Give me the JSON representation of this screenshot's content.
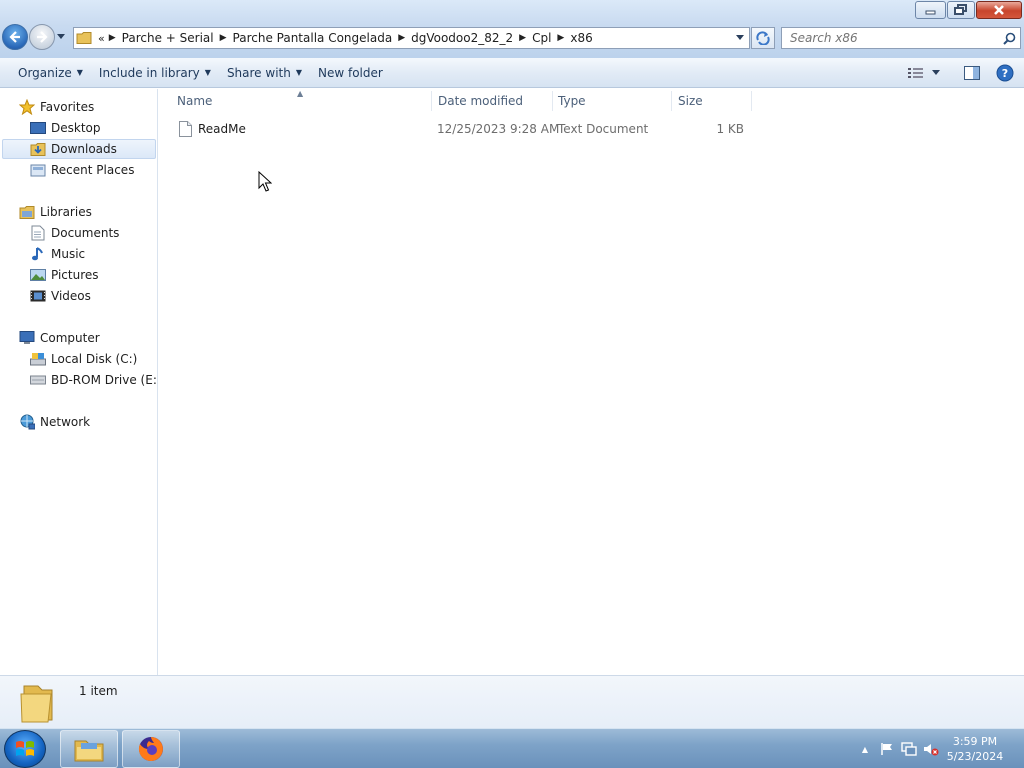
{
  "window": {
    "controls": {
      "minimize": "minimize",
      "maximize": "restore",
      "close": "close"
    }
  },
  "address": {
    "overflow": "«",
    "crumbs": [
      "Parche + Serial",
      "Parche Pantalla Congelada",
      "dgVoodoo2_82_2",
      "Cpl",
      "x86"
    ]
  },
  "search": {
    "placeholder": "Search x86"
  },
  "toolbar": {
    "organize": "Organize",
    "include_in_library": "Include in library",
    "share_with": "Share with",
    "new_folder": "New folder"
  },
  "navpane": {
    "favorites": "Favorites",
    "desktop": "Desktop",
    "downloads": "Downloads",
    "recent_places": "Recent Places",
    "libraries": "Libraries",
    "documents": "Documents",
    "music": "Music",
    "pictures": "Pictures",
    "videos": "Videos",
    "computer": "Computer",
    "local_disk": "Local Disk (C:)",
    "bd_rom": "BD-ROM Drive (E:) T",
    "network": "Network"
  },
  "columns": {
    "name": "Name",
    "date_modified": "Date modified",
    "type": "Type",
    "size": "Size"
  },
  "files": [
    {
      "name": "ReadMe",
      "date_modified": "12/25/2023 9:28 AM",
      "type": "Text Document",
      "size": "1 KB"
    }
  ],
  "details": {
    "item_count": "1 item"
  },
  "taskbar": {
    "time": "3:59 PM",
    "date": "5/23/2024",
    "tray_expand": "▲"
  },
  "colors": {
    "accent": "#2a68b8",
    "selection": "#dce8f8",
    "taskbar": "#7ea3c8"
  }
}
